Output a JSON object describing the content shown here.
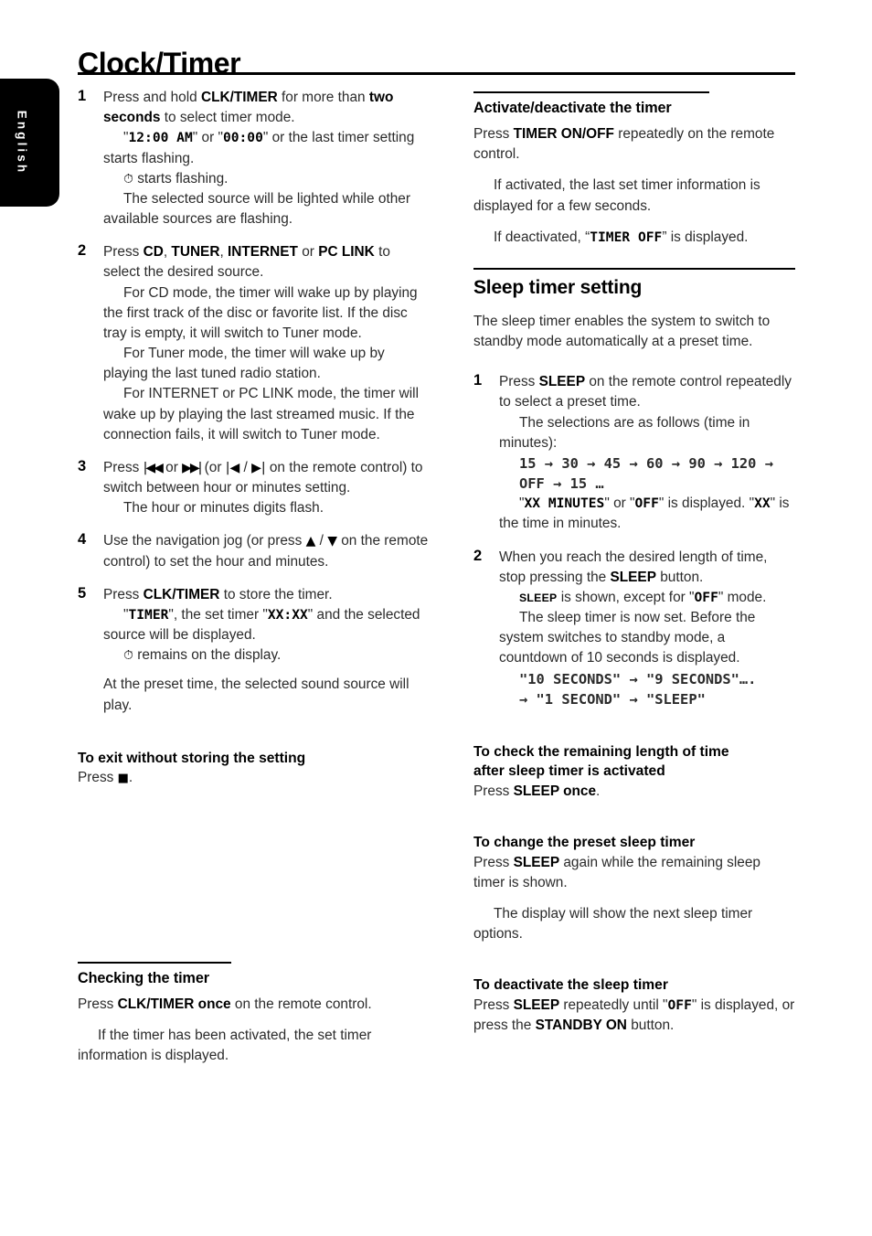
{
  "language_tab": {
    "label": "English"
  },
  "page": {
    "title": "Clock/Timer"
  },
  "left_column": {
    "steps": [
      {
        "number": "1",
        "line1_a": "Press and hold ",
        "line1_b": "CLK/TIMER",
        "line1_c": " for more than ",
        "line1_d": "two seconds",
        "line1_e": " to select timer mode.",
        "display_1": "12:00 AM",
        "display_2": "00:00",
        "line2_a": "\"",
        "line2_b": "\" or \"",
        "line2_c": "\" or the last timer setting starts flashing.",
        "icon_line": " starts flashing.",
        "line3": "The selected source will be lighted while other available sources are flashing.",
        "clock_icon": "clock-icon"
      },
      {
        "number": "2",
        "line1_a": "Press ",
        "src_cd": "CD",
        "src_tuner": "TUNER",
        "src_internet": "INTERNET",
        "src_pclink": "PC LINK",
        "line1_b": ", ",
        "line1_c": " or ",
        "line1_d": " to select the desired source.",
        "para_cd": "For CD mode, the timer will wake up by playing the first track of the disc or favorite list.  If the disc tray is empty, it will switch to Tuner mode.",
        "para_tuner": "For Tuner mode, the timer will wake up by playing the last tuned radio station.",
        "para_net": "For INTERNET or PC LINK mode, the timer will wake up by playing the last streamed music. If the connection fails, it will switch to Tuner mode."
      },
      {
        "number": "3",
        "text_a": "Press ",
        "sym_prev": "|◀◀",
        "text_b": " or ",
        "sym_next": "▶▶|",
        "text_c": "  (or ",
        "sym_prev_rc": "|◀",
        "text_d": " / ",
        "sym_next_rc": "▶|",
        "text_e": " on the remote control) to switch between hour or minutes setting.",
        "sub": "The hour or minutes digits flash."
      },
      {
        "number": "4",
        "text_a": "Use the navigation jog (or press ",
        "sym_up": "▲",
        "text_b": " / ",
        "sym_down": "▼",
        "text_c": " on the remote control) to set the hour and minutes."
      },
      {
        "number": "5",
        "text_a": "Press ",
        "btn": "CLK/TIMER",
        "text_b": " to store the timer.",
        "display_timer": "TIMER",
        "display_xxxx": "XX:XX",
        "line2_a": "\"",
        "line2_b": "\", the set timer \"",
        "line2_c": "\" and the selected source will be displayed.",
        "icon_line": " remains on the display.",
        "clock_icon": "clock-icon",
        "closing": "At the preset time, the selected sound source will play."
      }
    ],
    "exit_section": {
      "heading": "To exit without storing the setting",
      "text_a": "Press ",
      "stop_symbol": "■",
      "text_b": "."
    },
    "checking_section": {
      "heading": "Checking the timer",
      "line1_a": "Press ",
      "line1_b": "CLK/TIMER once",
      "line1_c": " on the remote control.",
      "line2": "If the timer has been activated, the set timer information is displayed."
    }
  },
  "right_column": {
    "activate_section": {
      "heading": "Activate/deactivate the timer",
      "line1_a": "Press ",
      "line1_b": "TIMER ON/OFF",
      "line1_c": " repeatedly on the remote control.",
      "line2": "If activated, the last set timer information is displayed for a few seconds.",
      "line3_a": "If deactivated, “",
      "display_timer_off": "TIMER OFF",
      "line3_b": "” is displayed."
    },
    "sleep_section": {
      "heading": "Sleep timer setting",
      "intro": "The sleep timer enables the system to switch to standby mode automatically at a preset time.",
      "steps": [
        {
          "number": "1",
          "text_a": "Press ",
          "btn": "SLEEP",
          "text_b": " on the remote control repeatedly to select a preset time.",
          "sub": "The selections are as follows (time in minutes):",
          "sequence_line1": "15 → 30 → 45 → 60 → 90 → 120 →",
          "sequence_line2": "OFF → 15 …",
          "note_a": "\"",
          "note_disp1": "XX MINUTES",
          "note_b": "\" or \"",
          "note_disp2": "OFF",
          "note_c": "\" is displayed. \"",
          "note_disp3": "XX",
          "note_d": "\" is the time in minutes."
        },
        {
          "number": "2",
          "text_a": "When you reach the desired length of time, stop pressing the ",
          "btn": "SLEEP",
          "text_b": " button.",
          "indicator": "SLEEP",
          "line2_a": " is shown, except for \"",
          "line2_disp": "OFF",
          "line2_b": "\" mode.",
          "line3": "The sleep timer is now set. Before the system switches to standby mode, a countdown of 10 seconds is displayed.",
          "countdown_line1": "\"10 SECONDS\" → \"9 SECONDS\"….",
          "countdown_line2": "→ \"1 SECOND\" → \"SLEEP\""
        }
      ]
    },
    "check_remaining_section": {
      "heading_line1": "To check the remaining length of time",
      "heading_line2": "after sleep timer is activated",
      "text_a": "Press ",
      "btn": "SLEEP once",
      "text_b": "."
    },
    "change_preset_section": {
      "heading": "To change the preset sleep timer",
      "text_a": "Press ",
      "btn": "SLEEP",
      "text_b": " again while the remaining sleep timer is shown.",
      "sub": "The display will show the next sleep timer options."
    },
    "deactivate_section": {
      "heading": " To deactivate the sleep timer",
      "text_a": "Press ",
      "btn1": "SLEEP",
      "text_b": " repeatedly until \"",
      "display_off": "OFF",
      "text_c": "\" is displayed, or press the ",
      "btn2": "STANDBY ON",
      "text_d": " button."
    }
  }
}
